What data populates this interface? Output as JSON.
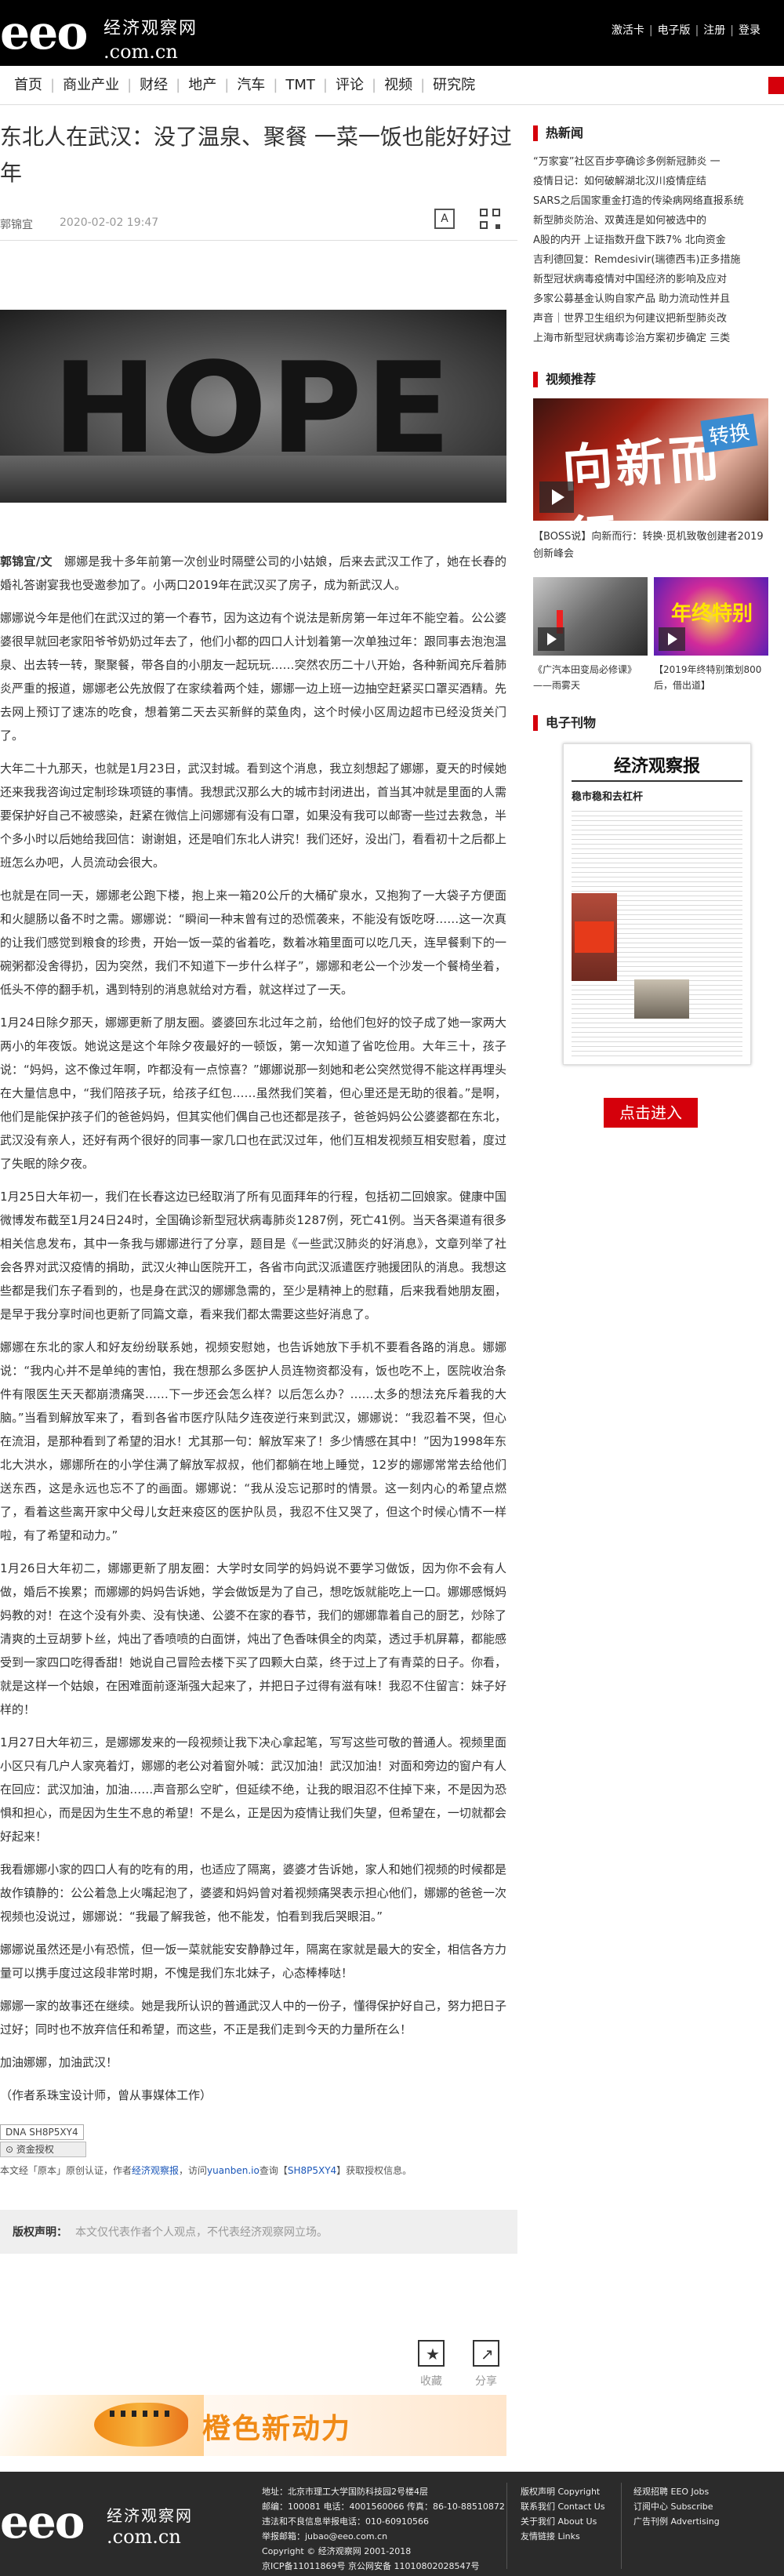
{
  "header": {
    "logo_text": "eeo",
    "logo_cn": "经济观察网",
    "logo_url": ".com.cn",
    "links": [
      "激活卡",
      "电子版",
      "注册",
      "登录"
    ]
  },
  "nav": {
    "items": [
      "首页",
      "商业产业",
      "财经",
      "地产",
      "汽车",
      "TMT",
      "评论",
      "视频",
      "研究院"
    ]
  },
  "article": {
    "title": "东北人在武汉：没了温泉、聚餐 一菜一饭也能好好过年",
    "author": "郭锦宜",
    "date": "2020-02-02 19:47",
    "hero_word": "HOPE",
    "intro_author": "郭锦宜/文",
    "paragraphs": [
      "娜娜是我十多年前第一次创业时隔壁公司的小姑娘，后来去武汉工作了，她在长春的婚礼答谢宴我也受邀参加了。小两口2019年在武汉买了房子，成为新武汉人。",
      "娜娜说今年是他们在武汉过的第一个春节，因为这边有个说法是新房第一年过年不能空着。公公婆婆很早就回老家阳爷爷奶奶过年去了，他们小都的四口人计划着第一次单独过年：跟同事去泡泡温泉、出去转一转，聚聚餐，带各自的小朋友一起玩玩……突然农历二十八开始，各种新闻充斥着肺炎严重的报道，娜娜老公先放假了在家续着两个娃，娜娜一边上班一边抽空赶紧买口罩买酒精。先去网上预订了速冻的吃食，想着第二天去买新鲜的菜鱼肉，这个时候小区周边超市已经没货关门了。",
      "大年二十九那天，也就是1月23日，武汉封城。看到这个消息，我立刻想起了娜娜，夏天的时候她还来我我咨询过定制珍珠项链的事情。我想武汉那么大的城市封闭进出，首当其冲就是里面的人需要保护好自己不被感染，赶紧在微信上问娜娜有没有口罩，如果没有我可以邮寄一些过去救急，半个多小时以后她给我回信：谢谢姐，还是咱们东北人讲究！我们还好，没出门，看看初十之后都上班怎么办吧，人员流动会很大。",
      "也就是在同一天，娜娜老公跑下楼，抱上来一箱20公斤的大桶矿泉水，又抱狗了一大袋子方便面和火腿肠以备不时之需。娜娜说：“瞬间一种末曾有过的恐慌袭来，不能没有饭吃呀……这一次真的让我们感觉到粮食的珍贵，开始一饭一菜的省着吃，数着冰箱里面可以吃几天，连早餐剩下的一碗粥都没舍得扔，因为突然，我们不知道下一步什么样子”，娜娜和老公一个沙发一个餐椅坐着，低头不停的翻手机，遇到特别的消息就给对方看，就这样过了一天。",
      "1月24日除夕那天，娜娜更新了朋友圈。婆婆回东北过年之前，给他们包好的饺子成了她一家两大两小的年夜饭。她说这是这个年除夕夜最好的一顿饭，第一次知道了省吃俭用。大年三十，孩子说：“妈妈，这不像过年啊，咋都没有一点惊喜？”娜娜说那一刻她和老公突然觉得不能这样再埋头在大量信息中，“我们陪孩子玩，给孩子红包……虽然我们笑着，但心里还是无助的很着。”是啊，他们是能保护孩子们的爸爸妈妈，但其实他们偶自己也还都是孩子，爸爸妈妈公公婆婆都在东北，武汉没有亲人，还好有两个很好的同事一家几口也在武汉过年，他们互相发视频互相安慰着，度过了失眠的除夕夜。",
      "1月25日大年初一，我们在长春这边已经取消了所有见面拜年的行程，包括初二回娘家。健康中国微博发布截至1月24日24时，全国确诊新型冠状病毒肺炎1287例，死亡41例。当天各渠道有很多相关信息发布，其中一条我与娜娜进行了分享，题目是《一些武汉肺炎的好消息》，文章列举了社会各界对武汉疫情的捐助，武汉火神山医院开工，各省市向武汉派遣医疗驰援团队的消息。我想这些都是我们东子看到的，也是身在武汉的娜娜急需的，至少是精神上的慰藉，后来我看她朋友圈，是早于我分享时间也更新了同篇文章，看来我们都太需要这些好消息了。",
      "娜娜在东北的家人和好友纷纷联系她，视频安慰她，也告诉她放下手机不要看各路的消息。娜娜说：“我内心并不是单纯的害怕，我在想那么多医护人员连物资都没有，饭也吃不上，医院收治条件有限医生天天都崩溃痛哭……下一步还会怎么样？以后怎么办？……太多的想法充斥着我的大脑。”当看到解放军来了，看到各省市医疗队陆夕连夜逆行来到武汉，娜娜说：“我忍着不哭，但心在流泪，是那种看到了希望的泪水！尤其那一句：解放军来了！多少情感在其中！”因为1998年东北大洪水，娜娜所在的小学住满了解放军叔叔，他们都躺在地上睡觉，12岁的娜娜常常去给他们送东西，这是永远也忘不了的画面。娜娜说：“我从没忘记那时的情景。这一刻内心的希望点燃了，看着这些离开家中父母儿女赶来疫区的医护队员，我忍不住又哭了，但这个时候心情不一样啦，有了希望和动力。”",
      "1月26日大年初二，娜娜更新了朋友圈：大学时女同学的妈妈说不要学习做饭，因为你不会有人做，婚后不挨累；而娜娜的妈妈告诉她，学会做饭是为了自己，想吃饭就能吃上一口。娜娜感慨妈妈教的对！在这个没有外卖、没有快递、公婆不在家的春节，我们的娜娜靠着自己的厨艺，炒除了清爽的土豆胡萝卜丝，炖出了香喷喷的白面饼，炖出了色香味俱全的肉菜，透过手机屏幕，都能感受到一家四口吃得香甜！她说自己冒险去楼下买了四颗大白菜，终于过上了有青菜的日子。你看，就是这样一个姑娘，在困难面前逐渐强大起来了，并把日子过得有滋有味！我忍不住留言：妹子好样的！",
      "1月27日大年初三，是娜娜发来的一段视频让我下决心拿起笔，写写这些可敬的普通人。视频里面小区只有几户人家亮着灯，娜娜的老公对着窗外喊：武汉加油！武汉加油！对面和旁边的窗户有人在回应：武汉加油，加油……声音那么空旷，但延续不绝，让我的眼泪忍不住掉下来，不是因为恐惧和担心，而是因为生生不息的希望！不是么，正是因为疫情让我们失望，但希望在，一切就都会好起来！",
      "我看娜娜小家的四口人有的吃有的用，也适应了隔离，婆婆才告诉她，家人和她们视频的时候都是故作镇静的：公公着急上火嘴起泡了，婆婆和妈妈曾对着视频痛哭表示担心他们，娜娜的爸爸一次视频也没说过，娜娜说：“我最了解我爸，他不能发，怕看到我后哭眼泪。”",
      "娜娜说虽然还是小有恐慌，但一饭一菜就能安安静静过年，隔离在家就是最大的安全，相信各方力量可以携手度过这段非常时期，不愧是我们东北妹子，心态棒棒哒！",
      "娜娜一家的故事还在继续。她是我所认识的普通武汉人中的一份子，懂得保护好自己，努力把日子过好；同时也不放弃信任和希望，而这些，不正是我们走到今天的力量所在么！",
      "加油娜娜，加油武汉！",
      "（作者系珠宝设计师，曾从事媒体工作）"
    ],
    "dna_code": "DNA SH8P5XY4",
    "dna_button": "资金授权",
    "copyright_note_1": "本文经「原本」原创认证，作者",
    "copyright_link_1": "经济观察报",
    "copyright_note_2": "，访问",
    "copyright_link_2": "yuanben.io",
    "copyright_note_3": "查询【",
    "copyright_link_3": "SH8P5XY4",
    "copyright_note_4": "】获取授权信息。",
    "statement_label": "版权声明：",
    "statement_text": "本文仅代表作者个人观点，不代表经济观察网立场。",
    "actions": [
      "收藏",
      "分享"
    ]
  },
  "banner": {
    "text": "橙色新动力"
  },
  "sidebar": {
    "hot_title": "热新闻",
    "hot_items": [
      "“万家宴”社区百步亭确诊多例新冠肺炎 一",
      "疫情日记：如何破解湖北汉川疫情症结",
      "SARS之后国家重金打造的传染病网络直报系统",
      "新型肺炎防治、双黄连是如何被选中的",
      "A股的内开 上证指数开盘下跌7% 北向资金",
      "吉利德回复：Remdesivir(瑞德西韦)正多措施",
      "新型冠状病毒疫情对中国经济的影响及应对",
      "多家公募基金认购自家产品 助力流动性并且",
      "声音｜世界卫生组织为何建议把新型肺炎改",
      "上海市新型冠状病毒诊治方案初步确定 三类"
    ],
    "video_title": "视频推荐",
    "video_main_text": "向新而行",
    "video_main_tag": "转换",
    "video_main_caption": "【BOSS说】向新而行：转换·觅机致敬创建者2019创新峰会",
    "video_small": [
      {
        "caption": "《广汽本田变局必修课》——雨雾天"
      },
      {
        "caption": "【2019年终特别策划800后，借出道】",
        "thumb_text": "年终特别"
      }
    ],
    "epaper_title": "电子刊物",
    "epaper_masthead": "经济观察报",
    "epaper_headline": "稳市稳和去杠杆",
    "enter_button": "点击进入"
  },
  "footer": {
    "logo_text": "eeo",
    "logo_cn": "经济观察网",
    "logo_url": ".com.cn",
    "info": [
      "地址：北京市理工大学国防科技园2号楼4层",
      "邮编：100081  电话：4001560066 传真：86-10-88510872",
      "违法和不良信息举报电话：010-60910566",
      "举报邮箱：jubao@eeo.com.cn",
      "Copyright © 经济观察网 2001-2018",
      "京ICP备11011869号   京公网安备 11010802028547号"
    ],
    "col1": [
      "版权声明 Copyright",
      "联系我们 Contact Us",
      "关于我们 About Us",
      "友情链接 Links"
    ],
    "col2": [
      "经观招聘 EEO Jobs",
      "订阅中心 Subscribe",
      "广告刊例 Advertising"
    ]
  }
}
